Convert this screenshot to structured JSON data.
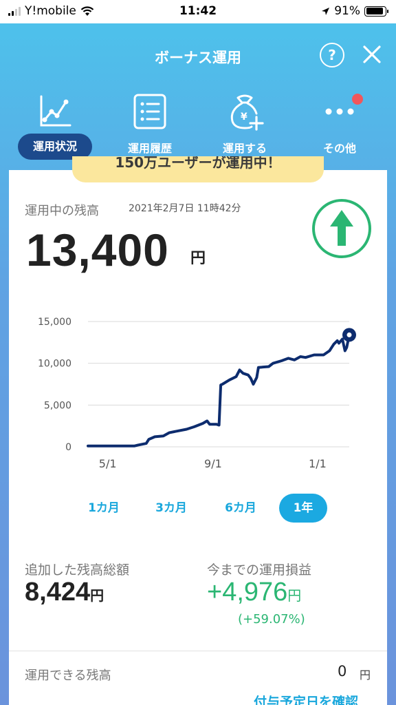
{
  "status_bar": {
    "carrier": "Y!mobile",
    "time": "11:42",
    "battery": "91%",
    "battery_level": 0.91
  },
  "header": {
    "title": "ボーナス運用",
    "help_label": "?"
  },
  "tabs": [
    {
      "label": "運用状況",
      "icon": "line-chart-icon",
      "active": true
    },
    {
      "label": "運用履歴",
      "icon": "list-icon",
      "active": false
    },
    {
      "label": "運用する",
      "icon": "money-bag-plus-icon",
      "active": false
    },
    {
      "label": "その他",
      "icon": "more-dots-icon",
      "active": false
    }
  ],
  "banner": {
    "text": "150万ユーザーが運用中！"
  },
  "balance": {
    "label": "運用中の残高",
    "date": "2021年2月7日 11時42分",
    "value": "13,400",
    "unit": "円",
    "trend_icon": "up-arrow-icon"
  },
  "chart_data": {
    "type": "line",
    "x_tick_labels": [
      "5/1",
      "9/1",
      "1/1"
    ],
    "y_ticks": [
      0,
      5000,
      10000,
      15000
    ],
    "y_tick_labels": [
      "0",
      "5,000",
      "10,000",
      "15,000"
    ],
    "ylim": [
      0,
      15000
    ],
    "x_domain": [
      "2020-04-08",
      "2021-02-07"
    ],
    "grid": true,
    "series": [
      {
        "points": [
          [
            "2020-04-08",
            100
          ],
          [
            "2020-05-01",
            100
          ],
          [
            "2020-06-01",
            100
          ],
          [
            "2020-06-05",
            200
          ],
          [
            "2020-06-15",
            400
          ],
          [
            "2020-06-18",
            900
          ],
          [
            "2020-06-25",
            1200
          ],
          [
            "2020-07-05",
            1300
          ],
          [
            "2020-07-12",
            1700
          ],
          [
            "2020-07-22",
            1900
          ],
          [
            "2020-08-01",
            2100
          ],
          [
            "2020-08-10",
            2400
          ],
          [
            "2020-08-20",
            2800
          ],
          [
            "2020-08-25",
            3100
          ],
          [
            "2020-08-28",
            2700
          ],
          [
            "2020-09-05",
            2700
          ],
          [
            "2020-09-08",
            2600
          ],
          [
            "2020-09-10",
            7400
          ],
          [
            "2020-09-12",
            7500
          ],
          [
            "2020-09-20",
            8000
          ],
          [
            "2020-09-28",
            8400
          ],
          [
            "2020-10-02",
            9200
          ],
          [
            "2020-10-06",
            8800
          ],
          [
            "2020-10-12",
            8600
          ],
          [
            "2020-10-15",
            8200
          ],
          [
            "2020-10-18",
            7500
          ],
          [
            "2020-10-22",
            8300
          ],
          [
            "2020-10-24",
            9500
          ],
          [
            "2020-11-05",
            9600
          ],
          [
            "2020-11-10",
            10000
          ],
          [
            "2020-11-20",
            10300
          ],
          [
            "2020-11-28",
            10600
          ],
          [
            "2020-12-05",
            10400
          ],
          [
            "2020-12-12",
            10800
          ],
          [
            "2020-12-18",
            10700
          ],
          [
            "2020-12-28",
            11000
          ],
          [
            "2021-01-08",
            11000
          ],
          [
            "2021-01-15",
            11500
          ],
          [
            "2021-01-20",
            12300
          ],
          [
            "2021-01-24",
            12700
          ],
          [
            "2021-01-26",
            12400
          ],
          [
            "2021-01-30",
            12900
          ],
          [
            "2021-02-02",
            11500
          ],
          [
            "2021-02-04",
            11900
          ],
          [
            "2021-02-07",
            13400
          ]
        ]
      }
    ],
    "colors": {
      "line": "#0d2c6e",
      "grid": "#d9d9d9",
      "axis_text": "#555555"
    }
  },
  "periods": [
    {
      "label": "1カ月",
      "active": false
    },
    {
      "label": "3カ月",
      "active": false
    },
    {
      "label": "6カ月",
      "active": false
    },
    {
      "label": "1年",
      "active": true
    }
  ],
  "stats": {
    "added_label": "追加した残高総額",
    "added_value": "8,424",
    "added_unit": "円",
    "gain_label": "今までの運用損益",
    "gain_value": "+4,976",
    "gain_unit": "円",
    "gain_percent": "(+59.07%)"
  },
  "available": {
    "label": "運用できる残高",
    "value": "0",
    "unit": "円",
    "link_text": "付与予定日を確認"
  },
  "colors": {
    "accent": "#1ba9e1",
    "dark_blue": "#1c4a8c",
    "gain_green": "#2bb673",
    "badge_red": "#f0575c",
    "banner_yellow": "#fbe79d"
  }
}
